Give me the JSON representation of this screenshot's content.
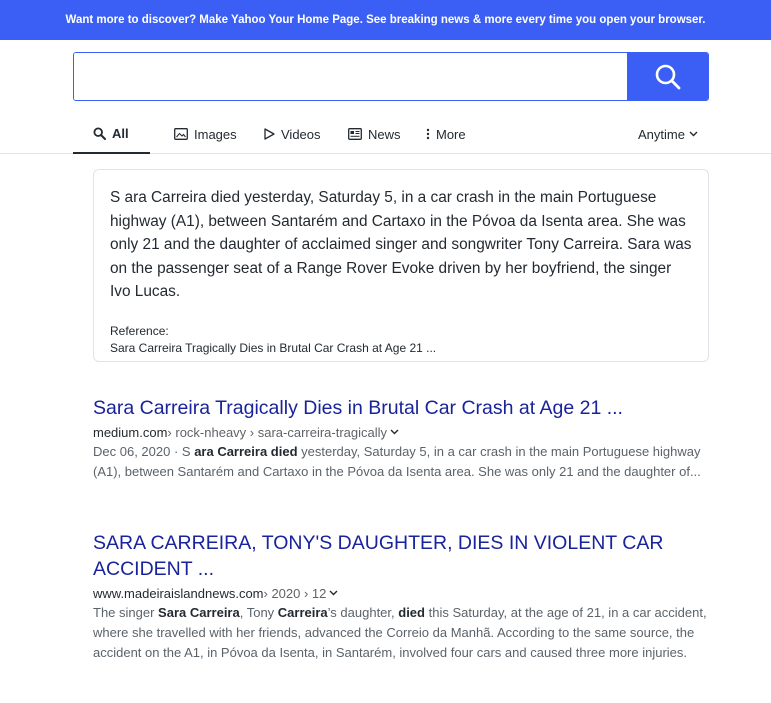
{
  "banner": {
    "text": "Want more to discover? Make Yahoo Your Home Page. See breaking news & more every time you open your browser."
  },
  "search": {
    "value": "",
    "placeholder": ""
  },
  "tabs": {
    "all": "All",
    "images": "Images",
    "videos": "Videos",
    "news": "News",
    "more": "More",
    "anytime": "Anytime"
  },
  "snippet": {
    "text": "S ara Carreira died yesterday, Saturday 5, in a car crash in the main Portuguese highway (A1), between Santarém and Cartaxo in the Póvoa da Isenta area. She was only 21 and the daughter of acclaimed singer and songwriter Tony Carreira. Sara was on the passenger seat of a Range Rover Evoke driven by her boyfriend, the singer Ivo Lucas.",
    "reference_label": "Reference:",
    "reference_link": "Sara Carreira Tragically Dies in Brutal Car Crash at Age 21 ..."
  },
  "results": [
    {
      "title": "Sara Carreira Tragically Dies in Brutal Car Crash at Age 21 ...",
      "domain": "medium.com",
      "path": " › rock-nheavy › sara-carreira-tragically",
      "date": "Dec 06, 2020 · ",
      "desc_1": "S ",
      "bold_1": "ara Carreira died",
      "desc_2": " yesterday, Saturday 5, in a car crash in the main Portuguese highway (A1), between Santarém and Cartaxo in the Póvoa da Isenta area. She was only 21 and the daughter of..."
    },
    {
      "title": "SARA CARREIRA, TONY'S DAUGHTER, DIES IN VIOLENT CAR ACCIDENT ...",
      "domain": "www.madeiraislandnews.com",
      "path": " › 2020 › 12",
      "desc_1": "The singer ",
      "bold_1": "Sara Carreira",
      "desc_2": ", Tony ",
      "bold_2": "Carreira",
      "desc_3": "’s daughter, ",
      "bold_3": "died",
      "desc_4": " this Saturday, at the age of 21, in a car accident, where she travelled with her friends, advanced the Correio da Manhã. According to the same source, the accident on the A1, in Póvoa da Isenta, in Santarém, involved four cars and caused three more injuries."
    }
  ],
  "colors": {
    "brand_blue": "#3b5ff5",
    "link": "#19239b"
  },
  "icons": [
    "search-icon",
    "images-icon",
    "videos-icon",
    "news-icon",
    "more-dots-icon",
    "chevron-down-icon"
  ]
}
